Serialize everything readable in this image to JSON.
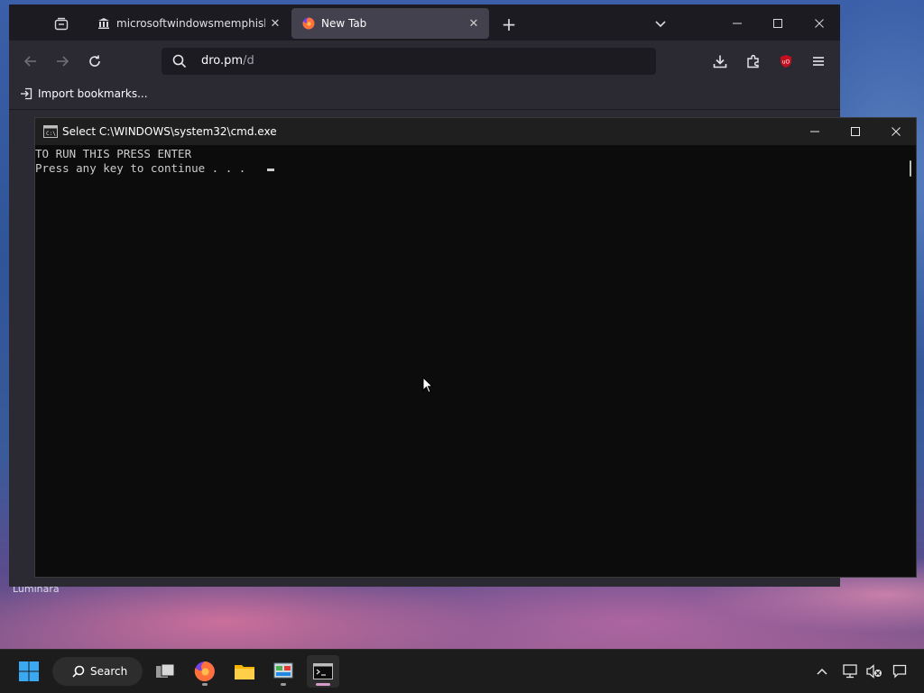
{
  "desktop": {
    "label": "Luminara"
  },
  "firefox": {
    "tabs": [
      {
        "label": "microsoftwindowsmemphisbu",
        "favicon": "archive-building-icon",
        "active": false
      },
      {
        "label": "New Tab",
        "favicon": "firefox-icon",
        "active": true
      }
    ],
    "url": {
      "host": "dro.pm",
      "path": "/d"
    },
    "bookmarks": {
      "import_label": "Import bookmarks..."
    }
  },
  "cmd": {
    "title": "Select C:\\WINDOWS\\system32\\cmd.exe",
    "lines": [
      "TO RUN THIS PRESS ENTER",
      "Press any key to continue . . ."
    ]
  },
  "taskbar": {
    "search_label": "Search"
  },
  "colors": {
    "cmd_bg": "#0c0c0c",
    "ff_dark": "#1c1b22",
    "ff_toolbar": "#2b2a33",
    "taskbar": "#1c1c1c"
  }
}
